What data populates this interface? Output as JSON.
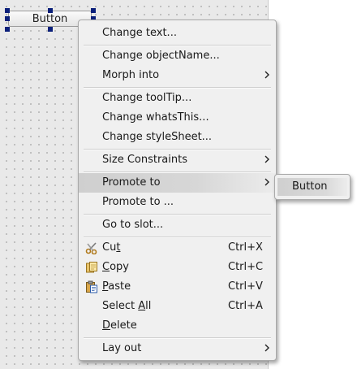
{
  "form": {
    "button_text": "Button"
  },
  "menu": {
    "change_text": "Change text...",
    "change_object_name": "Change objectName...",
    "morph_into": "Morph into",
    "change_tooltip": "Change toolTip...",
    "change_whats_this": "Change whatsThis...",
    "change_style_sheet": "Change styleSheet...",
    "size_constraints": "Size Constraints",
    "promote_to": "Promote to",
    "promote_to_dialog": "Promote to ...",
    "go_to_slot": "Go to slot...",
    "cut": {
      "pre": "Cu",
      "acc": "t",
      "post": "",
      "shortcut": "Ctrl+X",
      "icon": "scissors-icon"
    },
    "copy": {
      "pre": "",
      "acc": "C",
      "post": "opy",
      "shortcut": "Ctrl+C",
      "icon": "copy-icon"
    },
    "paste": {
      "pre": "",
      "acc": "P",
      "post": "aste",
      "shortcut": "Ctrl+V",
      "icon": "paste-icon"
    },
    "select_all": {
      "pre": "Select ",
      "acc": "A",
      "post": "ll",
      "shortcut": "Ctrl+A"
    },
    "delete": {
      "pre": "",
      "acc": "D",
      "post": "elete"
    },
    "lay_out": "Lay out"
  },
  "submenu": {
    "promote_button": "Button"
  },
  "colors": {
    "selection_handle": "#0a1f7a",
    "menu_background": "#f0f0f0",
    "highlight": "#d0d0d0"
  }
}
